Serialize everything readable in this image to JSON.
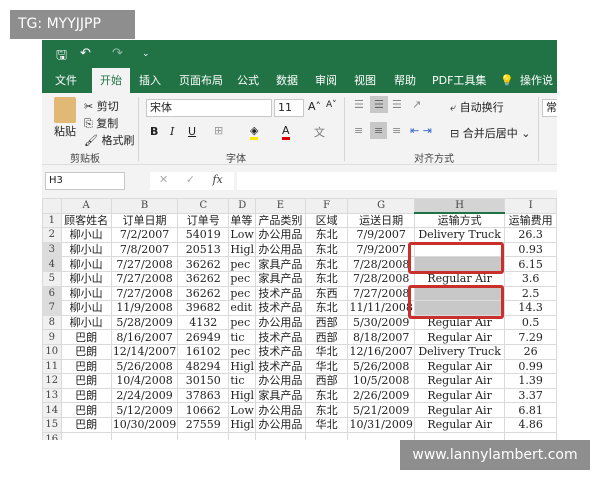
{
  "overlay": {
    "tag": "TG: MYYJJPP",
    "watermark": "www.lannylambert.com"
  },
  "quick_access": {
    "save": "🖫",
    "undo": "↶",
    "redo": "↷",
    "customize": "⌄"
  },
  "tabs": [
    "文件",
    "开始",
    "插入",
    "页面布局",
    "公式",
    "数据",
    "审阅",
    "视图",
    "帮助",
    "PDF工具集"
  ],
  "tell_me": "操作说明",
  "ribbon": {
    "clipboard": {
      "paste": "粘贴",
      "cut": "剪切",
      "copy": "复制",
      "format_painter": "格式刷",
      "group": "剪贴板"
    },
    "font": {
      "name": "宋体",
      "size": "11",
      "grow": "A˄",
      "shrink": "A˅",
      "bold": "B",
      "italic": "I",
      "underline": "U",
      "group": "字体"
    },
    "alignment": {
      "wrap": "自动换行",
      "merge": "合并后居中",
      "group": "对齐方式"
    },
    "number": {
      "format": "常规"
    }
  },
  "formula_bar": {
    "name_box": "H3",
    "cancel": "✕",
    "enter": "✓",
    "fx": "fx",
    "value": ""
  },
  "accent": "#217346",
  "sheet": {
    "columns": [
      "A",
      "B",
      "C",
      "D",
      "E",
      "F",
      "G",
      "H",
      "I"
    ],
    "selected_cell": "H3",
    "rows": [
      [
        "顾客姓名",
        "订单日期",
        "订单号",
        "单等",
        "产品类别",
        "区域",
        "运送日期",
        "运输方式",
        "运输费用"
      ],
      [
        "柳小山",
        "7/2/2007",
        "54019",
        "Low",
        "办公用品",
        "东北",
        "7/9/2007",
        "Delivery Truck",
        "26.3"
      ],
      [
        "柳小山",
        "7/8/2007",
        "20513",
        "Higl",
        "办公用品",
        "东北",
        "7/9/2007",
        "",
        "0.93"
      ],
      [
        "柳小山",
        "7/27/2008",
        "36262",
        "pec",
        "家具产品",
        "东北",
        "7/28/2008",
        "",
        "6.15"
      ],
      [
        "柳小山",
        "7/27/2008",
        "36262",
        "pec",
        "家具产品",
        "东北",
        "7/28/2008",
        "Regular Air",
        "3.6"
      ],
      [
        "柳小山",
        "7/27/2008",
        "36262",
        "pec",
        "技术产品",
        "东西",
        "7/27/2008",
        "",
        "2.5"
      ],
      [
        "柳小山",
        "11/9/2008",
        "39682",
        "edit",
        "技术产品",
        "东北",
        "11/11/2008",
        "",
        "14.3"
      ],
      [
        "柳小山",
        "5/28/2009",
        "4132",
        "pec",
        "办公用品",
        "西部",
        "5/30/2009",
        "Regular Air",
        "0.5"
      ],
      [
        "巴朗",
        "8/16/2007",
        "26949",
        "tic",
        "技术产品",
        "西部",
        "8/18/2007",
        "Regular Air",
        "7.29"
      ],
      [
        "巴朗",
        "12/14/2007",
        "16102",
        "pec",
        "技术产品",
        "华北",
        "12/16/2007",
        "Delivery Truck",
        "26"
      ],
      [
        "巴朗",
        "5/26/2008",
        "48294",
        "Higl",
        "技术产品",
        "华北",
        "5/26/2008",
        "Regular Air",
        "0.99"
      ],
      [
        "巴朗",
        "10/4/2008",
        "30150",
        "tic",
        "办公用品",
        "西部",
        "10/5/2008",
        "Regular Air",
        "1.39"
      ],
      [
        "巴朗",
        "2/24/2009",
        "37863",
        "Higl",
        "家具产品",
        "东北",
        "2/26/2009",
        "Regular Air",
        "3.37"
      ],
      [
        "巴朗",
        "5/12/2009",
        "10662",
        "Low",
        "办公用品",
        "东北",
        "5/21/2009",
        "Regular Air",
        "6.81"
      ],
      [
        "巴朗",
        "10/30/2009",
        "27559",
        "Higl",
        "办公用品",
        "华北",
        "10/31/2009",
        "Regular Air",
        "4.86"
      ],
      [
        "",
        "",
        "",
        "",
        "",
        "",
        "",
        "",
        ""
      ]
    ]
  }
}
